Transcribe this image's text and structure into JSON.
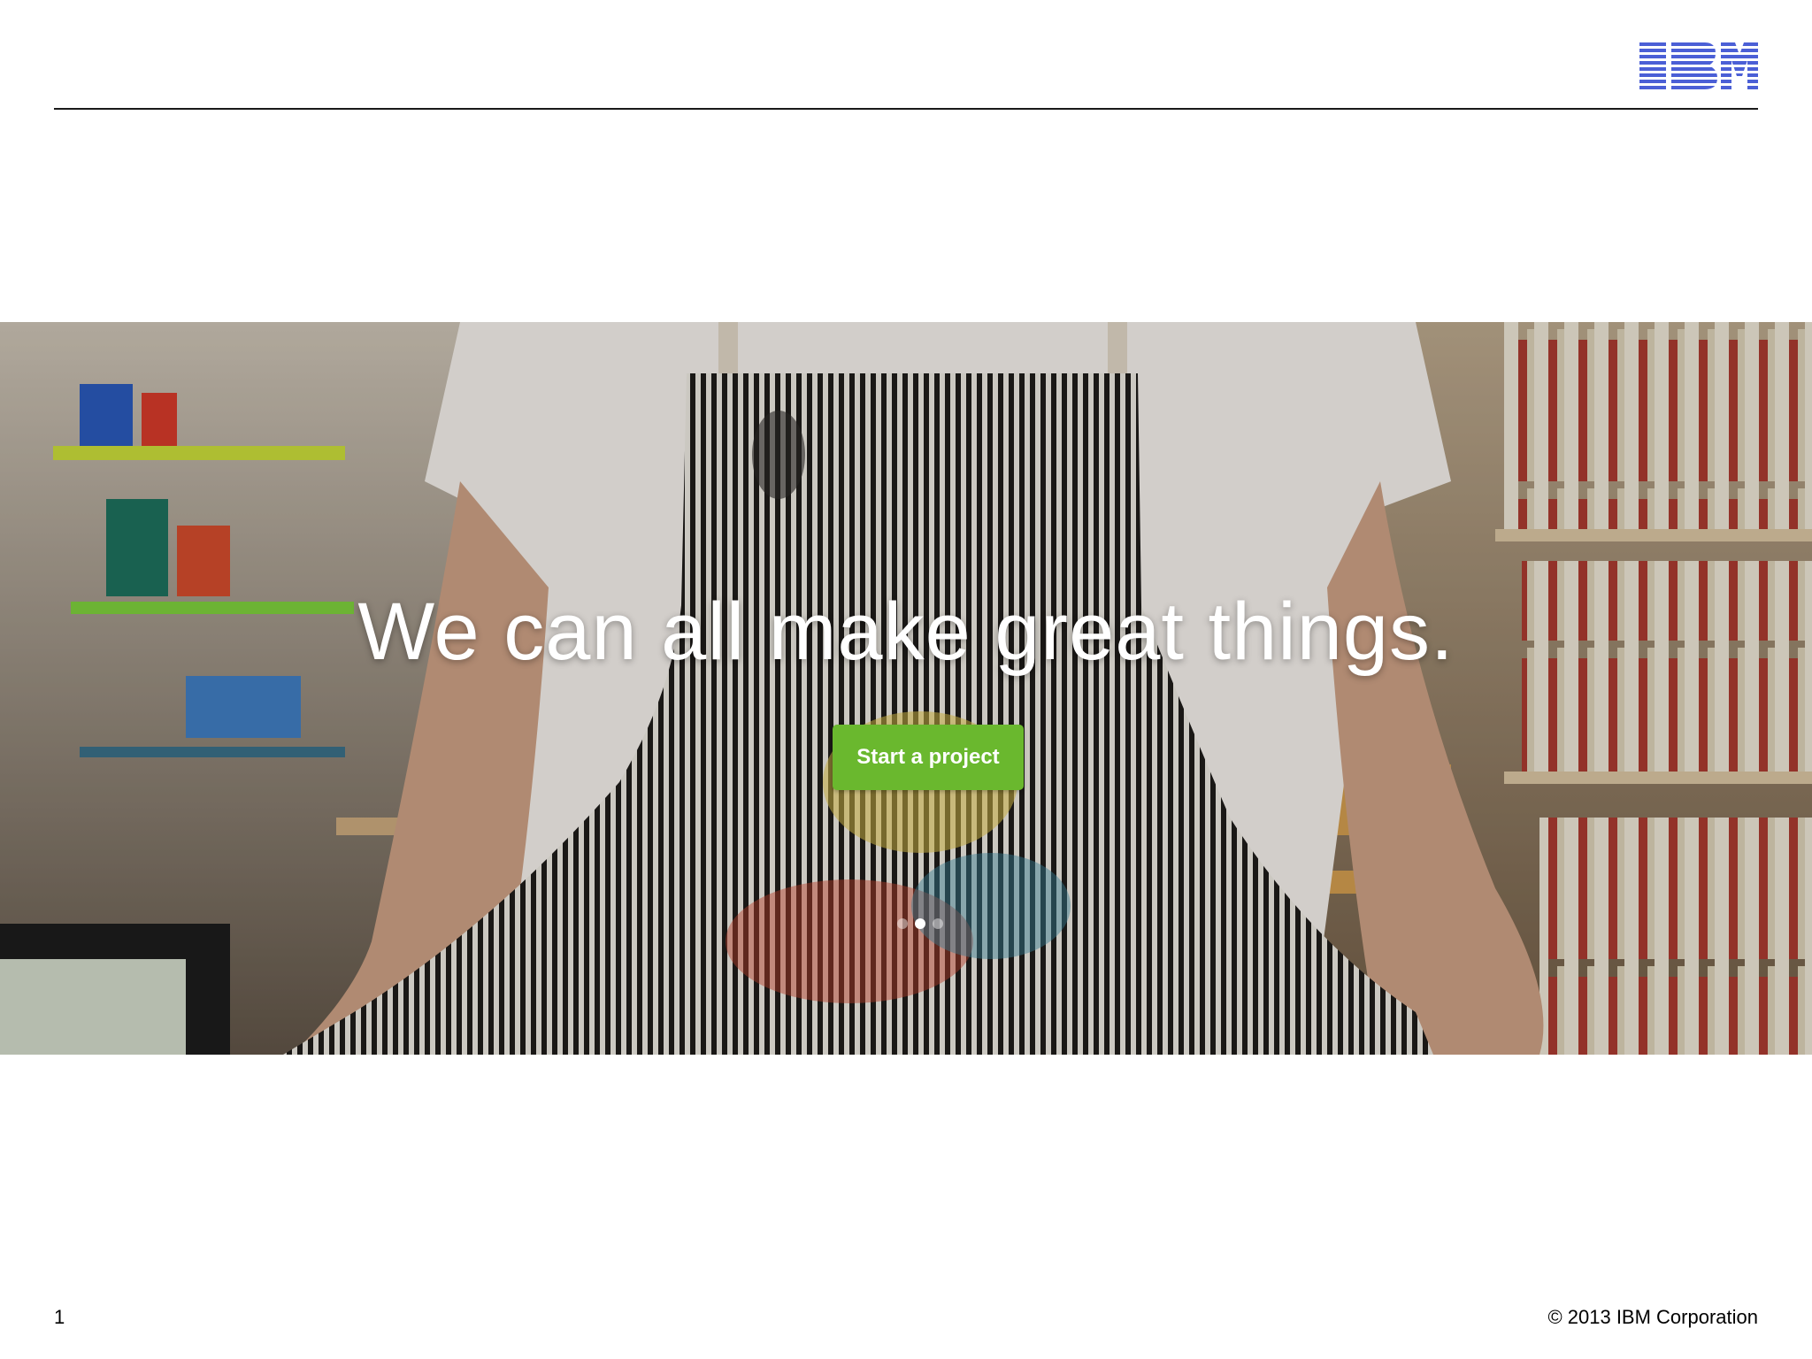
{
  "header": {
    "logo_text": "IBM",
    "logo_color": "#4b5fd6"
  },
  "hero": {
    "headline": "We can all make great things.",
    "cta_label": "Start a project",
    "cta_color": "#6ab82e",
    "carousel": {
      "count": 3,
      "active_index": 1
    }
  },
  "footer": {
    "page_number": "1",
    "copyright": "© 2013 IBM Corporation"
  }
}
